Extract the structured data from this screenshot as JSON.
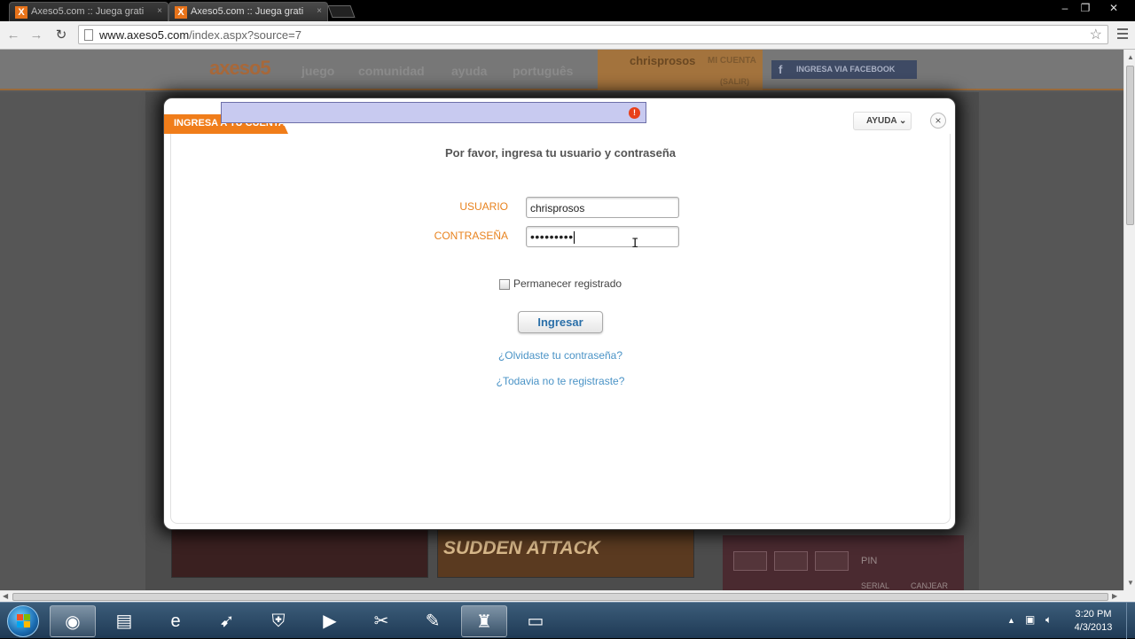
{
  "browser": {
    "tabs": [
      {
        "title": "Axeso5.com :: Juega grati",
        "close": "×",
        "favicon": "X"
      },
      {
        "title": "Axeso5.com :: Juega grati",
        "close": "×",
        "favicon": "X"
      }
    ],
    "window_buttons": {
      "minimize": "–",
      "restore": "❐",
      "close": "✕"
    },
    "nav": {
      "back": "←",
      "forward": "→",
      "reload": "↻"
    },
    "url_domain": "www.axeso5.com",
    "url_path": "/index.aspx?source=7",
    "star": "☆"
  },
  "site": {
    "logo": "axeso5",
    "nav": [
      "juego",
      "comunidad",
      "ayuda",
      "português"
    ],
    "username": "chrisprosos",
    "mi_cuenta": "MI CUENTA",
    "salir": "(SALIR)",
    "facebook_icon": "f",
    "facebook_label": "INGRESA VIA FACEBOOK",
    "game_banner": "SUDDEN ATTACK",
    "pin_label": "PIN",
    "serial_label": "SERIAL",
    "canjear_label": "CANJEAR"
  },
  "modal": {
    "tab_label": "INGRESA A TU CUENTA",
    "warning_icon": "!",
    "ayuda_label": "AYUDA ⌄",
    "close": "×",
    "heading": "Por favor, ingresa tu usuario y contraseña",
    "usuario_label": "USUARIO",
    "usuario_value": "chrisprosos",
    "contrasena_label": "CONTRASEÑA",
    "contrasena_value": "•••••••••",
    "remember_label": "Permanecer registrado",
    "submit_label": "Ingresar",
    "forgot_link": "¿Olvidaste tu contraseña?",
    "register_link": "¿Todavia no te registraste?"
  },
  "taskbar": {
    "apps": [
      {
        "name": "chrome",
        "glyph": "◉",
        "active": true
      },
      {
        "name": "explorer",
        "glyph": "▤",
        "active": false
      },
      {
        "name": "ie",
        "glyph": "e",
        "active": false
      },
      {
        "name": "weapon",
        "glyph": "➹",
        "active": false
      },
      {
        "name": "shield",
        "glyph": "⛨",
        "active": false
      },
      {
        "name": "media",
        "glyph": "▶",
        "active": false
      },
      {
        "name": "ccleaner",
        "glyph": "✂",
        "active": false
      },
      {
        "name": "paint",
        "glyph": "✎",
        "active": false
      },
      {
        "name": "game",
        "glyph": "♜",
        "active": false
      },
      {
        "name": "folder",
        "glyph": "▭",
        "active": false
      }
    ],
    "tray_arrow": "▲",
    "time": "3:20 PM",
    "date": "4/3/2013"
  },
  "colors": {
    "accent_orange": "#f07d1a",
    "label_orange": "#e8831f",
    "link_blue": "#4a93c6",
    "button_text": "#2a6fa8"
  }
}
